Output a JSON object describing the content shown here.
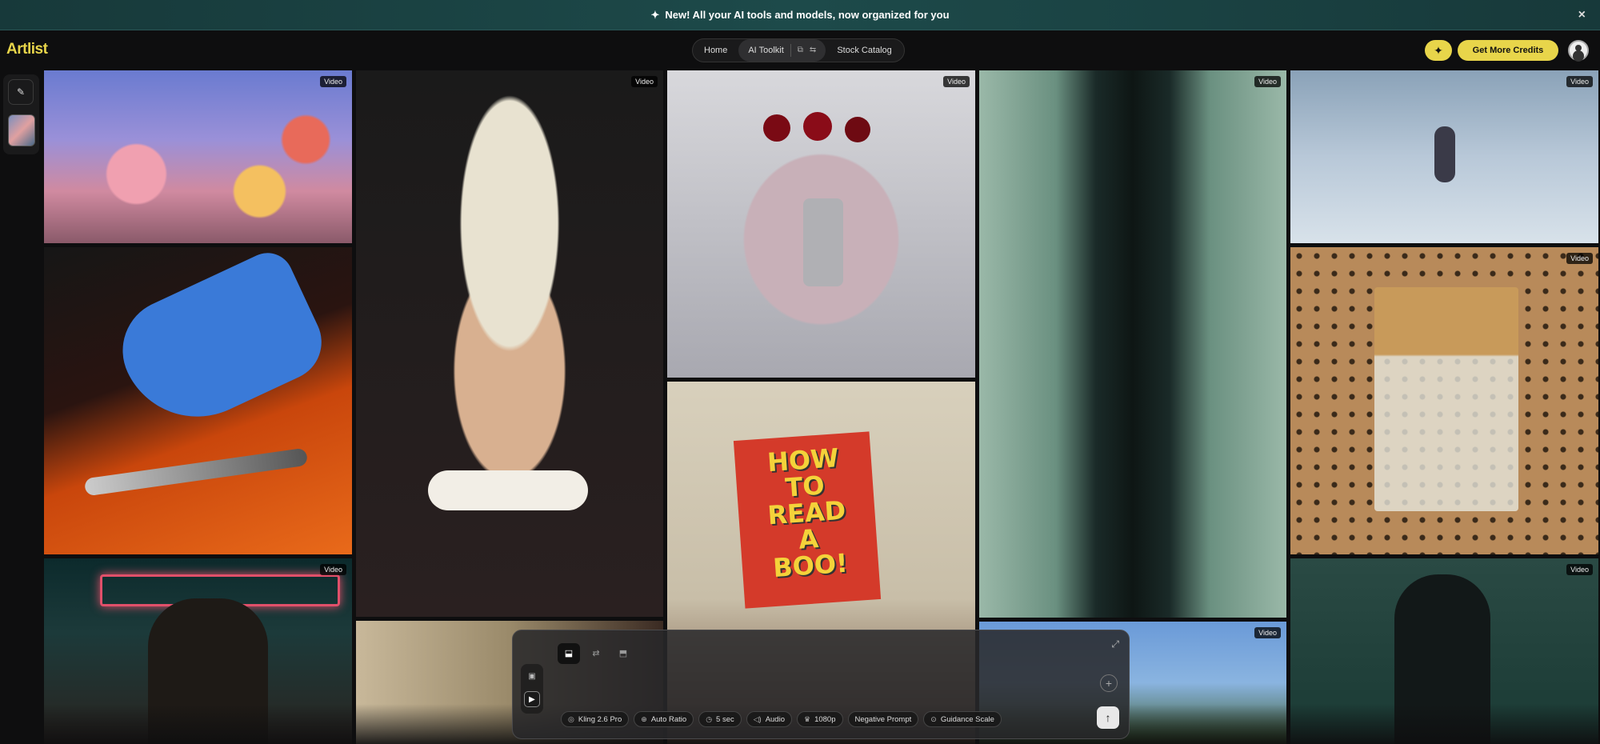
{
  "banner": {
    "spark_icon": "✦",
    "text": "New! All your AI tools and models, now organized for you",
    "close": "×"
  },
  "logo": {
    "text": "Artlist"
  },
  "nav": {
    "home": "Home",
    "ai_toolkit": "AI Toolkit",
    "stock_catalog": "Stock Catalog",
    "icon_a": "⧉",
    "icon_b": "⇆"
  },
  "header": {
    "spark_button": "✦",
    "credits_button": "Get More Credits"
  },
  "sidebar": {
    "new_icon": "✎"
  },
  "gallery": {
    "badge": "Video",
    "tiles": [
      {
        "name": "tile-flowers",
        "badge": "Video"
      },
      {
        "name": "tile-blue-hand",
        "badge": ""
      },
      {
        "name": "tile-neon-phone-man",
        "badge": "Video"
      },
      {
        "name": "tile-silver-woman",
        "badge": "Video"
      },
      {
        "name": "tile-plates-woman",
        "badge": ""
      },
      {
        "name": "tile-cherry-jelly",
        "badge": "Video"
      },
      {
        "name": "tile-read-a-book",
        "badge": ""
      },
      {
        "name": "tile-escalator",
        "badge": "Video"
      },
      {
        "name": "tile-trees-sky",
        "badge": "Video"
      },
      {
        "name": "tile-snow-child",
        "badge": "Video"
      },
      {
        "name": "tile-toy-horse",
        "badge": "Video"
      },
      {
        "name": "tile-suit-man",
        "badge": "Video"
      }
    ],
    "book_text": [
      "HOW",
      "TO",
      "READ",
      "A",
      "BOO!"
    ]
  },
  "composer": {
    "expand_icon": "⤢",
    "plus_icon": "+",
    "send_icon": "↑",
    "mode_image_icon": "▣",
    "mode_video_icon": "▶",
    "tab_icons": [
      "⬓",
      "⇄",
      "⬒"
    ],
    "chips": [
      {
        "icon": "◎",
        "label": "Kling 2.6 Pro"
      },
      {
        "icon": "⊕",
        "label": "Auto Ratio"
      },
      {
        "icon": "◷",
        "label": "5 sec"
      },
      {
        "icon": "◁)",
        "label": "Audio"
      },
      {
        "icon": "♛",
        "label": "1080p"
      },
      {
        "icon": "",
        "label": "Negative Prompt"
      },
      {
        "icon": "⊙",
        "label": "Guidance Scale"
      }
    ]
  }
}
